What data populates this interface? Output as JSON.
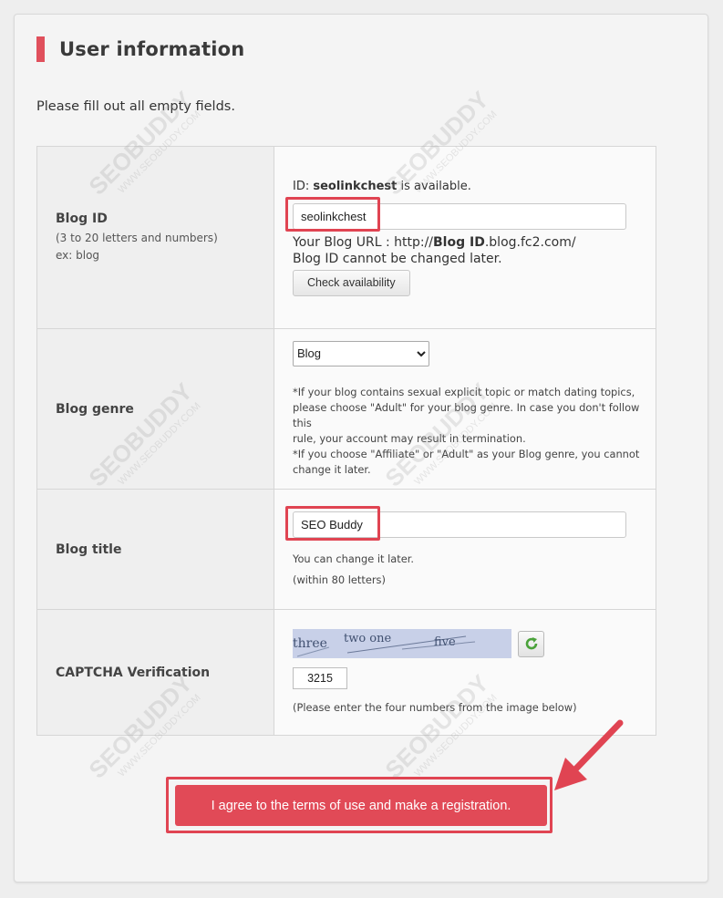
{
  "page": {
    "title": "User information",
    "intro": "Please fill out all empty fields."
  },
  "blog_id": {
    "label": "Blog ID",
    "hint1": "(3 to 20 letters and numbers)",
    "hint2": "ex: blog",
    "availability_prefix": "ID: ",
    "availability_id": "seolinkchest",
    "availability_suffix": " is available.",
    "value": "seolinkchest",
    "url_prefix": "Your Blog URL : http://",
    "url_bold": "Blog ID",
    "url_suffix": ".blog.fc2.com/",
    "note": "Blog ID cannot be changed later.",
    "check_button": "Check availability"
  },
  "blog_genre": {
    "label": "Blog genre",
    "selected": "Blog",
    "note_lines": [
      "*If your blog contains sexual explicit topic or match dating topics,",
      "please choose \"Adult\" for your blog genre. In case you don't follow this",
      "rule, your account may result in termination.",
      "*If you choose \"Affiliate\" or \"Adult\" as your Blog genre, you cannot",
      "change it later."
    ]
  },
  "blog_title": {
    "label": "Blog title",
    "value": "SEO Buddy",
    "note1": "You can change it later.",
    "note2": "(within 80 letters)"
  },
  "captcha": {
    "label": "CAPTCHA Verification",
    "image_words": [
      "three",
      "two one",
      "five"
    ],
    "value": "3215",
    "note": "(Please enter the four numbers from the image below)"
  },
  "submit": {
    "label": "I agree to the terms of use and make a registration."
  },
  "watermark": {
    "brand": "SEOBUDDY",
    "site": "WWW.SEOBUDDY.COM"
  },
  "colors": {
    "accent": "#e14a57",
    "highlight": "#e04452"
  },
  "icons": {
    "refresh": "refresh-icon",
    "arrow": "red-pointer-arrow"
  }
}
